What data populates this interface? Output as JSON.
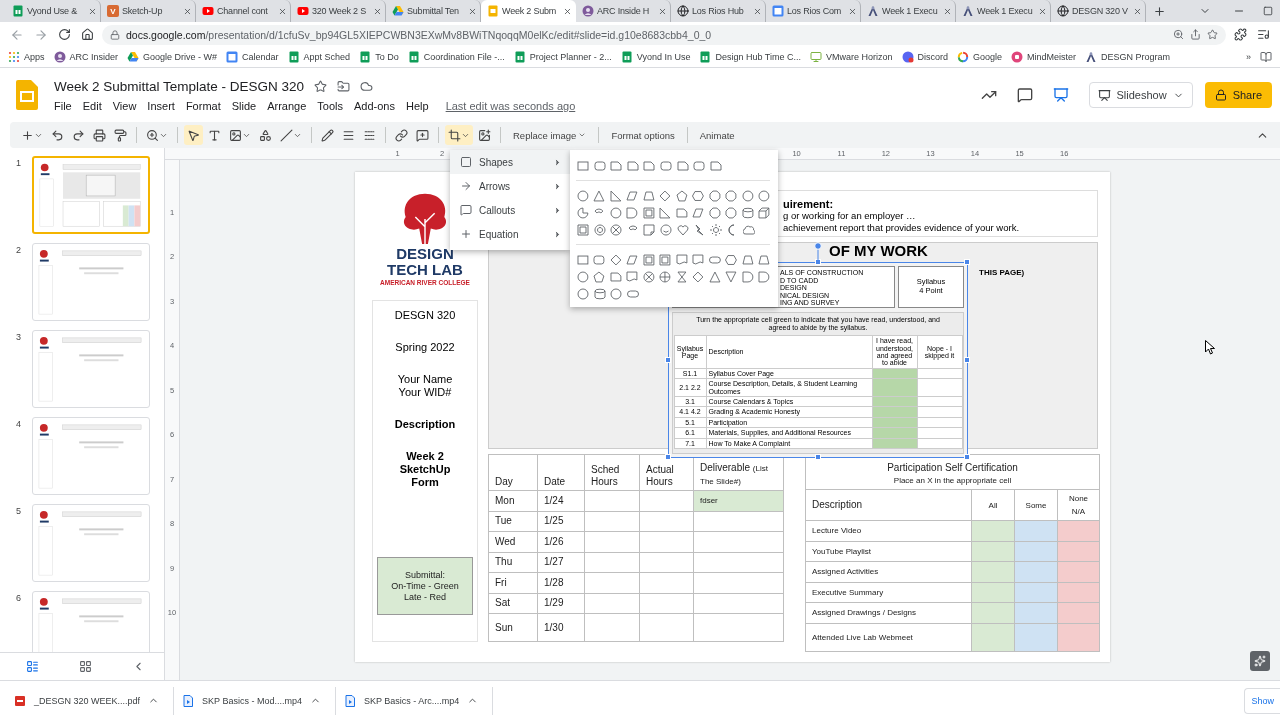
{
  "browser": {
    "tabs": [
      {
        "title": "Vyond Use &",
        "kind": "sheets",
        "selected": false
      },
      {
        "title": "Sketch-Up",
        "kind": "letter",
        "badge": "V",
        "selected": false
      },
      {
        "title": "Channel cont",
        "kind": "video",
        "selected": false
      },
      {
        "title": "320 Week 2 S",
        "kind": "video",
        "selected": false
      },
      {
        "title": "Submittal Ten",
        "kind": "drive",
        "selected": false
      },
      {
        "title": "Week 2 Subm",
        "kind": "slides",
        "selected": true
      },
      {
        "title": "ARC Inside H",
        "kind": "avatar",
        "selected": false
      },
      {
        "title": "Los Rios Hub",
        "kind": "globe",
        "selected": false
      },
      {
        "title": "Los Rios Com",
        "kind": "calendar",
        "selected": false
      },
      {
        "title": "Week 1 Execu",
        "kind": "logo",
        "selected": false
      },
      {
        "title": "Week 1 Execu",
        "kind": "logo",
        "selected": false
      },
      {
        "title": "DESGN 320 V",
        "kind": "globe",
        "selected": false
      }
    ],
    "url": {
      "host": "docs.google.com",
      "path": "/presentation/d/1cfuSv_bp94GL5XIEPCWBN3EXwMv8BWiTNqoqqM0elKc/edit#slide=id.g10e8683cbb4_0_0"
    },
    "bookmarks": [
      {
        "label": "Apps",
        "kind": "apps"
      },
      {
        "label": "ARC Insider",
        "kind": "avatar"
      },
      {
        "label": "Google Drive - W#",
        "kind": "drive"
      },
      {
        "label": "Calendar",
        "kind": "calendar"
      },
      {
        "label": "Appt Sched",
        "kind": "sheets"
      },
      {
        "label": "To Do",
        "kind": "sheets"
      },
      {
        "label": "Coordination File -...",
        "kind": "sheets"
      },
      {
        "label": "Project Planner - 2...",
        "kind": "sheets"
      },
      {
        "label": "Vyond In Use",
        "kind": "sheets"
      },
      {
        "label": "Design Hub Time C...",
        "kind": "sheets"
      },
      {
        "label": "VMware Horizon",
        "kind": "monitor"
      },
      {
        "label": "Discord",
        "kind": "discord"
      },
      {
        "label": "Google",
        "kind": "google"
      },
      {
        "label": "MindMeister",
        "kind": "mindmeister"
      },
      {
        "label": "DESGN Program",
        "kind": "logo"
      }
    ],
    "more": "»"
  },
  "docs": {
    "title": "Week 2 Submittal Template - DESGN 320",
    "menu": [
      "File",
      "Edit",
      "View",
      "Insert",
      "Format",
      "Slide",
      "Arrange",
      "Tools",
      "Add-ons",
      "Help"
    ],
    "last_edit": "Last edit was seconds ago",
    "slideshow": "Slideshow",
    "share": "Share"
  },
  "toolbar": {
    "select_tool": {
      "selected": true
    },
    "crop_tool": {
      "selected": true
    },
    "buttons": [
      "Replace image",
      "Format options",
      "Animate"
    ]
  },
  "insert_menu": {
    "items": [
      {
        "label": "Shapes",
        "kind": "shapes",
        "selected": true
      },
      {
        "label": "Arrows",
        "kind": "arrows",
        "selected": false
      },
      {
        "label": "Callouts",
        "kind": "callouts",
        "selected": false
      },
      {
        "label": "Equation",
        "kind": "equation",
        "selected": false
      }
    ]
  },
  "filmstrip": {
    "slides": [
      {
        "number": "1",
        "selected": true
      },
      {
        "number": "2",
        "selected": false
      },
      {
        "number": "3",
        "selected": false
      },
      {
        "number": "4",
        "selected": false
      },
      {
        "number": "5",
        "selected": false
      },
      {
        "number": "6",
        "selected": false
      }
    ]
  },
  "ruler": {
    "left_marks": [
      "1",
      "2"
    ],
    "right_marks": [
      "10",
      "11",
      "12",
      "13",
      "14",
      "15",
      "16"
    ],
    "side_marks": [
      "1",
      "2",
      "3",
      "4",
      "5",
      "6",
      "7",
      "8",
      "9",
      "10"
    ]
  },
  "slide": {
    "logo": {
      "line1": "DESIGN",
      "line2": "TECH LAB",
      "line3": "AMERICAN RIVER COLLEGE"
    },
    "info": [
      {
        "kind": "plain",
        "lines": [
          "DESGN 320"
        ]
      },
      {
        "kind": "plain",
        "lines": [
          "Spring 2022"
        ]
      },
      {
        "kind": "plain",
        "lines": [
          "Your Name",
          "Your WID#"
        ]
      },
      {
        "kind": "bold",
        "lines": [
          "Description"
        ]
      },
      {
        "kind": "bold",
        "lines": [
          "Week 2",
          "SketchUp",
          "Form"
        ]
      }
    ],
    "submittal": [
      "Submittal:",
      "On-Time - Green",
      "Late - Red"
    ],
    "requirement": {
      "heading": "uirement:",
      "lines": [
        "g or working for an employer …",
        "achievement report that provides evidence of your work."
      ]
    },
    "panel": {
      "heading": "OF MY WORK",
      "note": "THIS PAGE)"
    },
    "image": {
      "selected": true,
      "modules": [
        "ALS OF CONSTRUCTION",
        "D TO CADD",
        "DESIGN",
        "NICAL DESIGN",
        "ING AND SURVEY"
      ],
      "badge": [
        "Syllabus",
        "4 Point"
      ],
      "instructions": "Turn the appropriate cell green to indicate that you have read, understood, and agreed to abide by the syllabus.",
      "columns": [
        "Syllabus Page",
        "Description",
        "I have read, understood, and agreed to abide",
        "Nope - I skipped it"
      ],
      "rows": [
        {
          "page": "S1.1",
          "description": "Syllabus Cover Page",
          "read": true
        },
        {
          "page": "2.1  2.2",
          "description": "Course Description, Details, & Student Learning Outcomes",
          "read": true
        },
        {
          "page": "3.1",
          "description": "Course Calendars & Topics",
          "read": true
        },
        {
          "page": "4.1 4.2",
          "description": "Grading & Academic Honesty",
          "read": true
        },
        {
          "page": "5.1",
          "description": "Participation",
          "read": true
        },
        {
          "page": "6.1",
          "description": "Materials, Supplies, and Additional Resources",
          "read": true
        },
        {
          "page": "7.1",
          "description": "How To Make A Complaint",
          "read": true
        }
      ]
    },
    "schedule": {
      "columns": [
        {
          "label": "Day"
        },
        {
          "label": "Date"
        },
        {
          "label": "Sched Hours"
        },
        {
          "label": "Actual Hours"
        },
        {
          "label": "Deliverable",
          "note": "(List The Slide#)"
        }
      ],
      "rows": [
        {
          "day": "Mon",
          "date": "1/24",
          "deliverable": "fdser",
          "highlighted": true
        },
        {
          "day": "Tue",
          "date": "1/25",
          "highlighted": false
        },
        {
          "day": "Wed",
          "date": "1/26",
          "highlighted": false
        },
        {
          "day": "Thu",
          "date": "1/27",
          "highlighted": false
        },
        {
          "day": "Fri",
          "date": "1/28",
          "highlighted": false
        },
        {
          "day": "Sat",
          "date": "1/29",
          "highlighted": false
        },
        {
          "day": "Sun",
          "date": "1/30",
          "highlighted": false
        }
      ]
    },
    "participation": {
      "title": "Participation Self Certification",
      "subtitle": "Place an X in the appropriate cell",
      "columns": [
        {
          "label": "Description"
        },
        {
          "label": "All",
          "color": "#d9ead3"
        },
        {
          "label": "Some",
          "color": "#cfe2f3"
        },
        {
          "label": "None N/A",
          "color": "#f4cccc"
        }
      ],
      "rows": [
        "Lecture Video",
        "YouTube Playlist",
        "Assigned Activities",
        "Executive Summary",
        "Assigned Drawings / Designs",
        "Attended Live Lab Webmeet"
      ]
    }
  },
  "downloads": {
    "items": [
      {
        "name": "_DESGN 320 WEEK....pdf",
        "kind": "pdf"
      },
      {
        "name": "SKP Basics - Mod....mp4",
        "kind": "video"
      },
      {
        "name": "SKP Basics - Arc....mp4",
        "kind": "video"
      }
    ],
    "show_all": "Show"
  }
}
